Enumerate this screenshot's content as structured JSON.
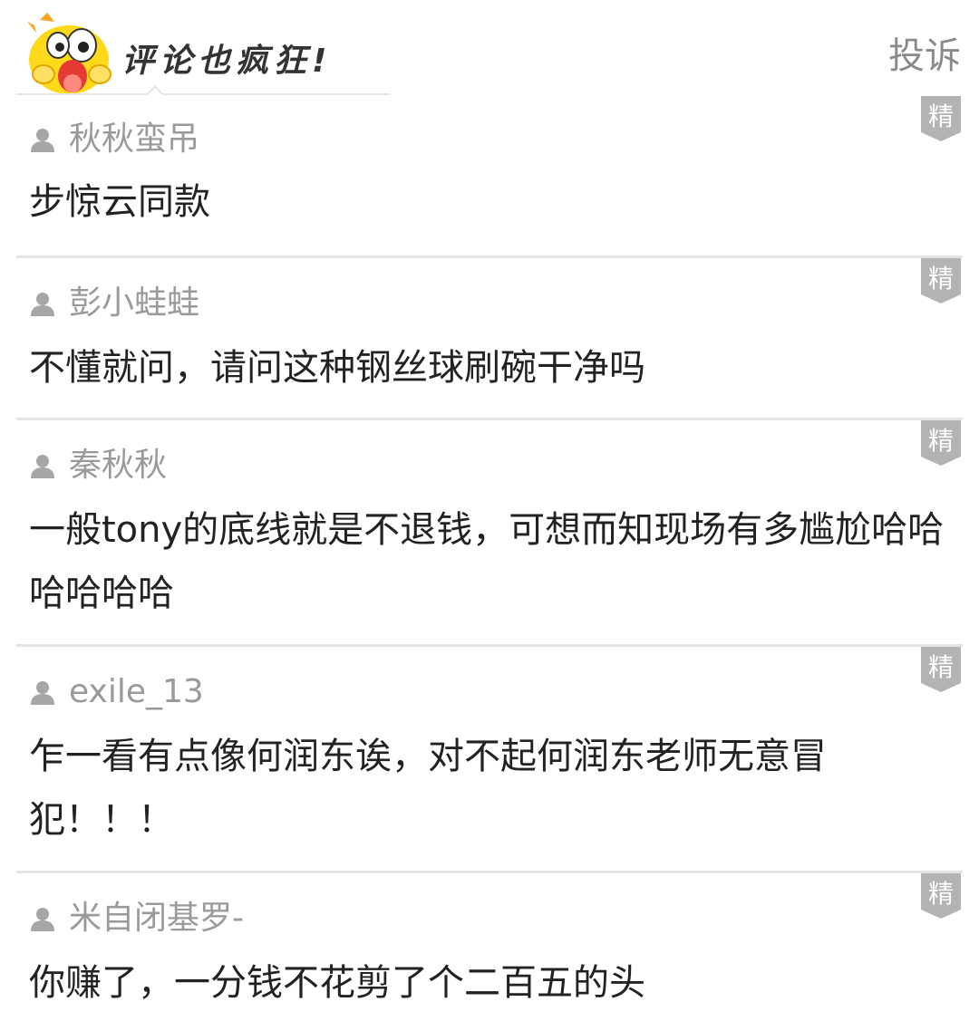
{
  "header": {
    "title": "评论也疯狂!",
    "report_label": "投诉"
  },
  "icons": {
    "mascot": "yellow-chick-mascot-icon",
    "user": "user-icon",
    "badge": "featured-badge-icon"
  },
  "colors": {
    "username": "#9a9a9a",
    "text": "#222222",
    "badge": "#b3b3b3",
    "divider": "#e4e4e4",
    "mascot_yellow": "#ffd91a"
  },
  "comments": [
    {
      "username": "秋秋蛮吊",
      "text": "步惊云同款",
      "badge": "精"
    },
    {
      "username": "彭小蛙蛙",
      "text": "不懂就问，请问这种钢丝球刷碗干净吗",
      "badge": "精"
    },
    {
      "username": "秦秋秋",
      "text": "一般tony的底线就是不退钱，可想而知现场有多尴尬哈哈哈哈哈哈",
      "badge": "精"
    },
    {
      "username": "exile_13",
      "text": "乍一看有点像何润东诶，对不起何润东老师无意冒犯！！！",
      "badge": "精"
    },
    {
      "username": "米自闭基罗-",
      "text": "你赚了，一分钱不花剪了个二百五的头",
      "badge": "精"
    }
  ]
}
